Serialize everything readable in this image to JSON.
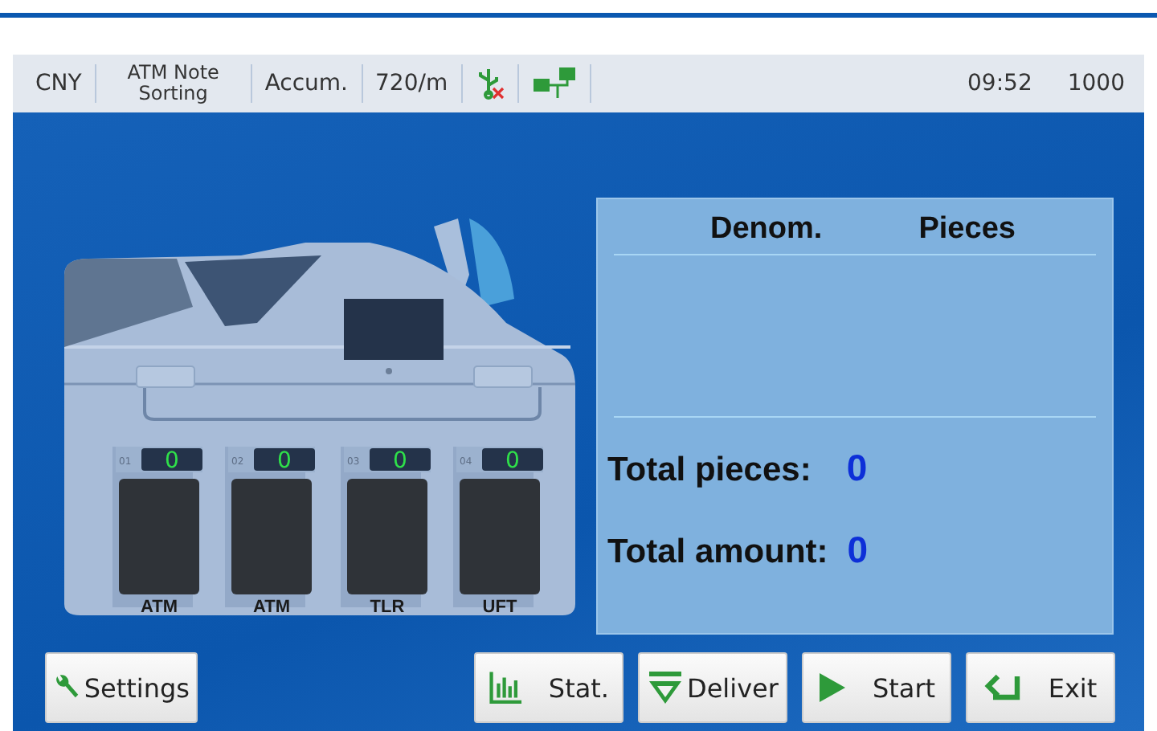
{
  "status_bar": {
    "currency": "CNY",
    "mode": "ATM Note Sorting",
    "count_mode": "Accum.",
    "speed": "720/m",
    "time": "09:52",
    "batch": "1000"
  },
  "pockets": [
    {
      "number": "01",
      "count": "0",
      "label": "ATM"
    },
    {
      "number": "02",
      "count": "0",
      "label": "ATM"
    },
    {
      "number": "03",
      "count": "0",
      "label": "TLR"
    },
    {
      "number": "04",
      "count": "0",
      "label": "UFT"
    }
  ],
  "table": {
    "columns": [
      "Denom.",
      "Pieces"
    ]
  },
  "totals": [
    {
      "label": "Total pieces:",
      "value": "0"
    },
    {
      "label": "Total amount:",
      "value": "0"
    }
  ],
  "buttons": [
    {
      "kind": "settings",
      "label": "Settings"
    },
    {
      "kind": "stats",
      "label": "Stat."
    },
    {
      "kind": "deliver",
      "label": "Deliver"
    },
    {
      "kind": "start",
      "label": "Start"
    },
    {
      "kind": "exit",
      "label": "Exit"
    }
  ]
}
